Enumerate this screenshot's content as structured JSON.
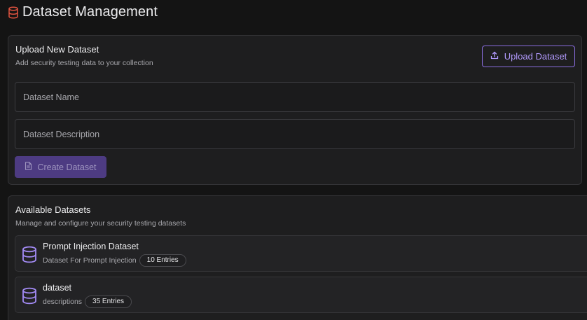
{
  "page": {
    "title": "Dataset Management",
    "icon": "database-icon",
    "accent_color": "#8b6ee0",
    "header_icon_color": "#e0533f"
  },
  "upload_card": {
    "title": "Upload New Dataset",
    "subtitle": "Add security testing data to your collection",
    "upload_button_label": "Upload Dataset",
    "upload_button_icon": "upload-icon",
    "name_placeholder": "Dataset Name",
    "description_placeholder": "Dataset Description",
    "create_button_label": "Create Dataset",
    "create_button_icon": "file-icon"
  },
  "available_card": {
    "title": "Available Datasets",
    "subtitle": "Manage and configure your security testing datasets",
    "items": [
      {
        "name": "Prompt Injection Dataset",
        "description": "Dataset For Prompt Injection",
        "entries": "10 Entries",
        "icon": "database-icon"
      },
      {
        "name": "dataset",
        "description": "descriptions",
        "entries": "35 Entries",
        "icon": "database-icon"
      }
    ]
  }
}
